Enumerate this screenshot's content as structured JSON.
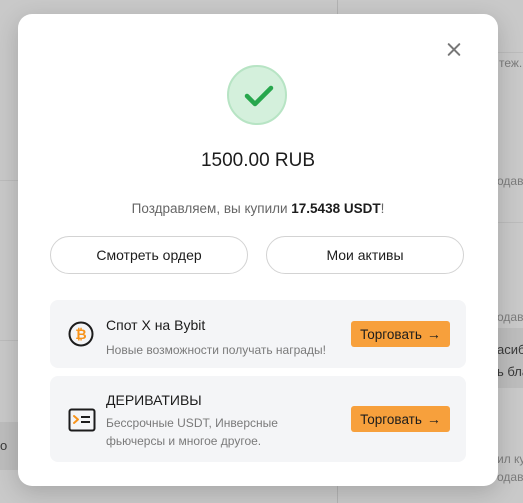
{
  "background": {
    "snippets": [
      "теж.",
      "одаве",
      "асиб",
      "ь бла",
      "одаве",
      "ил ку",
      "одаве",
      "о"
    ]
  },
  "modal": {
    "close_icon": "close-icon",
    "status_icon": "check-icon",
    "amount": "1500.00 RUB",
    "congrats_prefix": "Поздравляем, вы купили ",
    "congrats_value": "17.5438 USDT",
    "congrats_suffix": "!",
    "view_order_label": "Смотреть ордер",
    "my_assets_label": "Мои активы",
    "promos": [
      {
        "icon": "bitcoin-icon",
        "title": "Спот X на Bybit",
        "description": "Новые возможности получать награды!",
        "button_label": "Торговать",
        "button_icon": "→"
      },
      {
        "icon": "terminal-icon",
        "title": "ДЕРИВАТИВЫ",
        "description": "Бессрочные USDT, Инверсные фьючерсы и многое другое.",
        "button_label": "Торговать",
        "button_icon": "→"
      }
    ]
  },
  "colors": {
    "accent": "#f7a03c",
    "success": "#27a74d",
    "success_bg": "#d4f0dc"
  }
}
